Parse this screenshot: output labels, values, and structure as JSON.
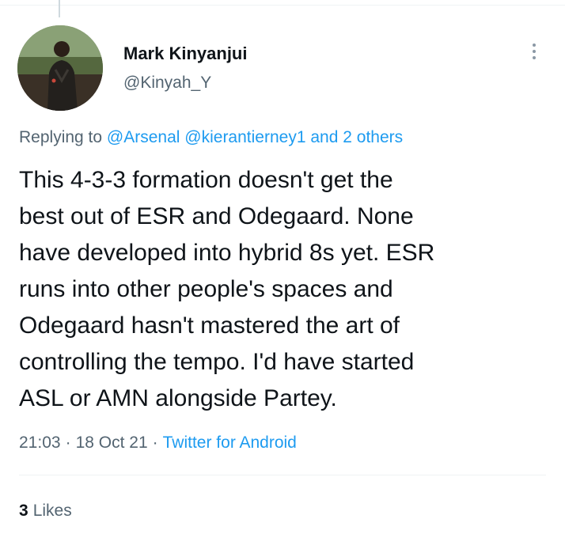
{
  "tweet": {
    "author": {
      "display_name": "Mark Kinyanjui",
      "handle": "@Kinyah_Y",
      "avatar_icon": "user-avatar-photo"
    },
    "replying": {
      "prefix": "Replying to",
      "mentions": [
        "@Arsenal",
        "@kierantierney1"
      ],
      "connector": "and",
      "others": "2 others"
    },
    "text_lines": [
      "This 4-3-3 formation doesn't get the",
      "best out of ESR and Odegaard. None",
      "have developed into hybrid 8s yet. ESR",
      "runs into other people's spaces and",
      "Odegaard hasn't mastered the art of",
      "controlling the tempo. I'd have started",
      "ASL or AMN alongside Partey."
    ],
    "time": "21:03",
    "date": "18 Oct 21",
    "separator": "·",
    "source": "Twitter for Android",
    "likes": {
      "count": "3",
      "label": "Likes"
    }
  },
  "colors": {
    "text": "#0f1419",
    "secondary": "#536471",
    "link": "#1d9bf0",
    "divider": "#eff3f4"
  }
}
